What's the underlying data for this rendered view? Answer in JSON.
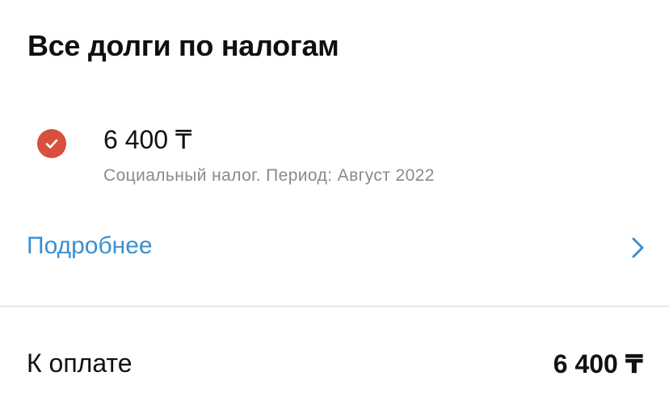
{
  "header": {
    "title": "Все долги по налогам"
  },
  "debt": {
    "amount": "6 400 ₸",
    "description": "Социальный налог. Период: Август 2022",
    "checked": true,
    "check_color": "#d94f3d",
    "icon": "check-circle-icon"
  },
  "details": {
    "label": "Подробнее",
    "link_color": "#3a8fd1",
    "icon": "chevron-right-icon"
  },
  "total": {
    "label": "К оплате",
    "value": "6 400 ₸"
  }
}
